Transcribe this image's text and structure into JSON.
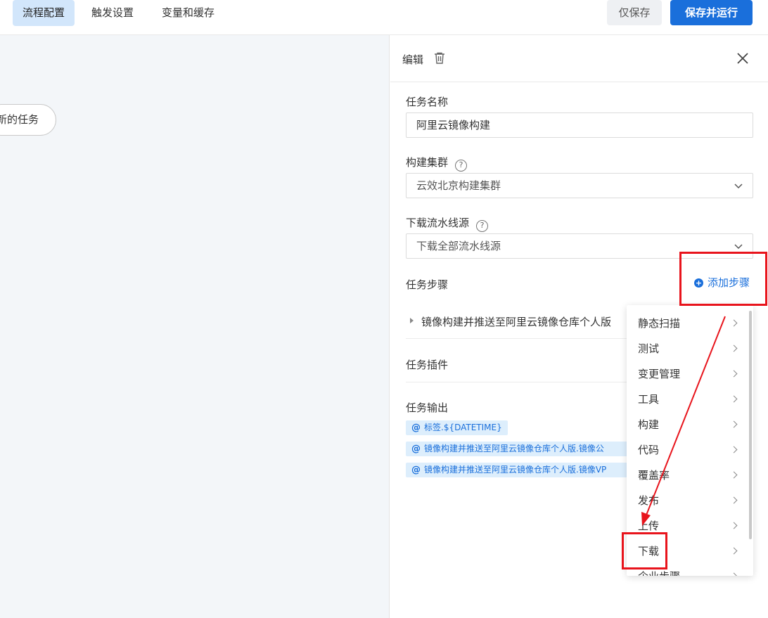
{
  "tabs": [
    {
      "label": "流程配置"
    },
    {
      "label": "触发设置"
    },
    {
      "label": "变量和缓存"
    }
  ],
  "actions": {
    "save_only": "仅保存",
    "save_run": "保存并运行"
  },
  "canvas": {
    "node_label": "新的任务"
  },
  "panel": {
    "title": "编辑",
    "task_name_label": "任务名称",
    "task_name_value": "阿里云镜像构建",
    "cluster_label": "构建集群",
    "cluster_value": "云效北京构建集群",
    "source_label": "下载流水线源",
    "source_value": "下载全部流水线源",
    "help_glyph": "?",
    "steps_label": "任务步骤",
    "add_step": "添加步骤",
    "step_item": "镜像构建并推送至阿里云镜像仓库个人版",
    "plugins_label": "任务插件",
    "outputs_label": "任务输出",
    "outputs": [
      "标签.${DATETIME}",
      "镜像构建并推送至阿里云镜像仓库个人版.镜像公",
      "镜像构建并推送至阿里云镜像仓库个人版.镜像VP"
    ]
  },
  "menu": {
    "items": [
      "静态扫描",
      "测试",
      "变更管理",
      "工具",
      "构建",
      "代码",
      "覆盖率",
      "发布",
      "上传",
      "下载",
      "企业步骤"
    ]
  },
  "colors": {
    "accent": "#1a6fdb",
    "highlight": "#e8141c",
    "tab_active": "#d2e6fb"
  }
}
